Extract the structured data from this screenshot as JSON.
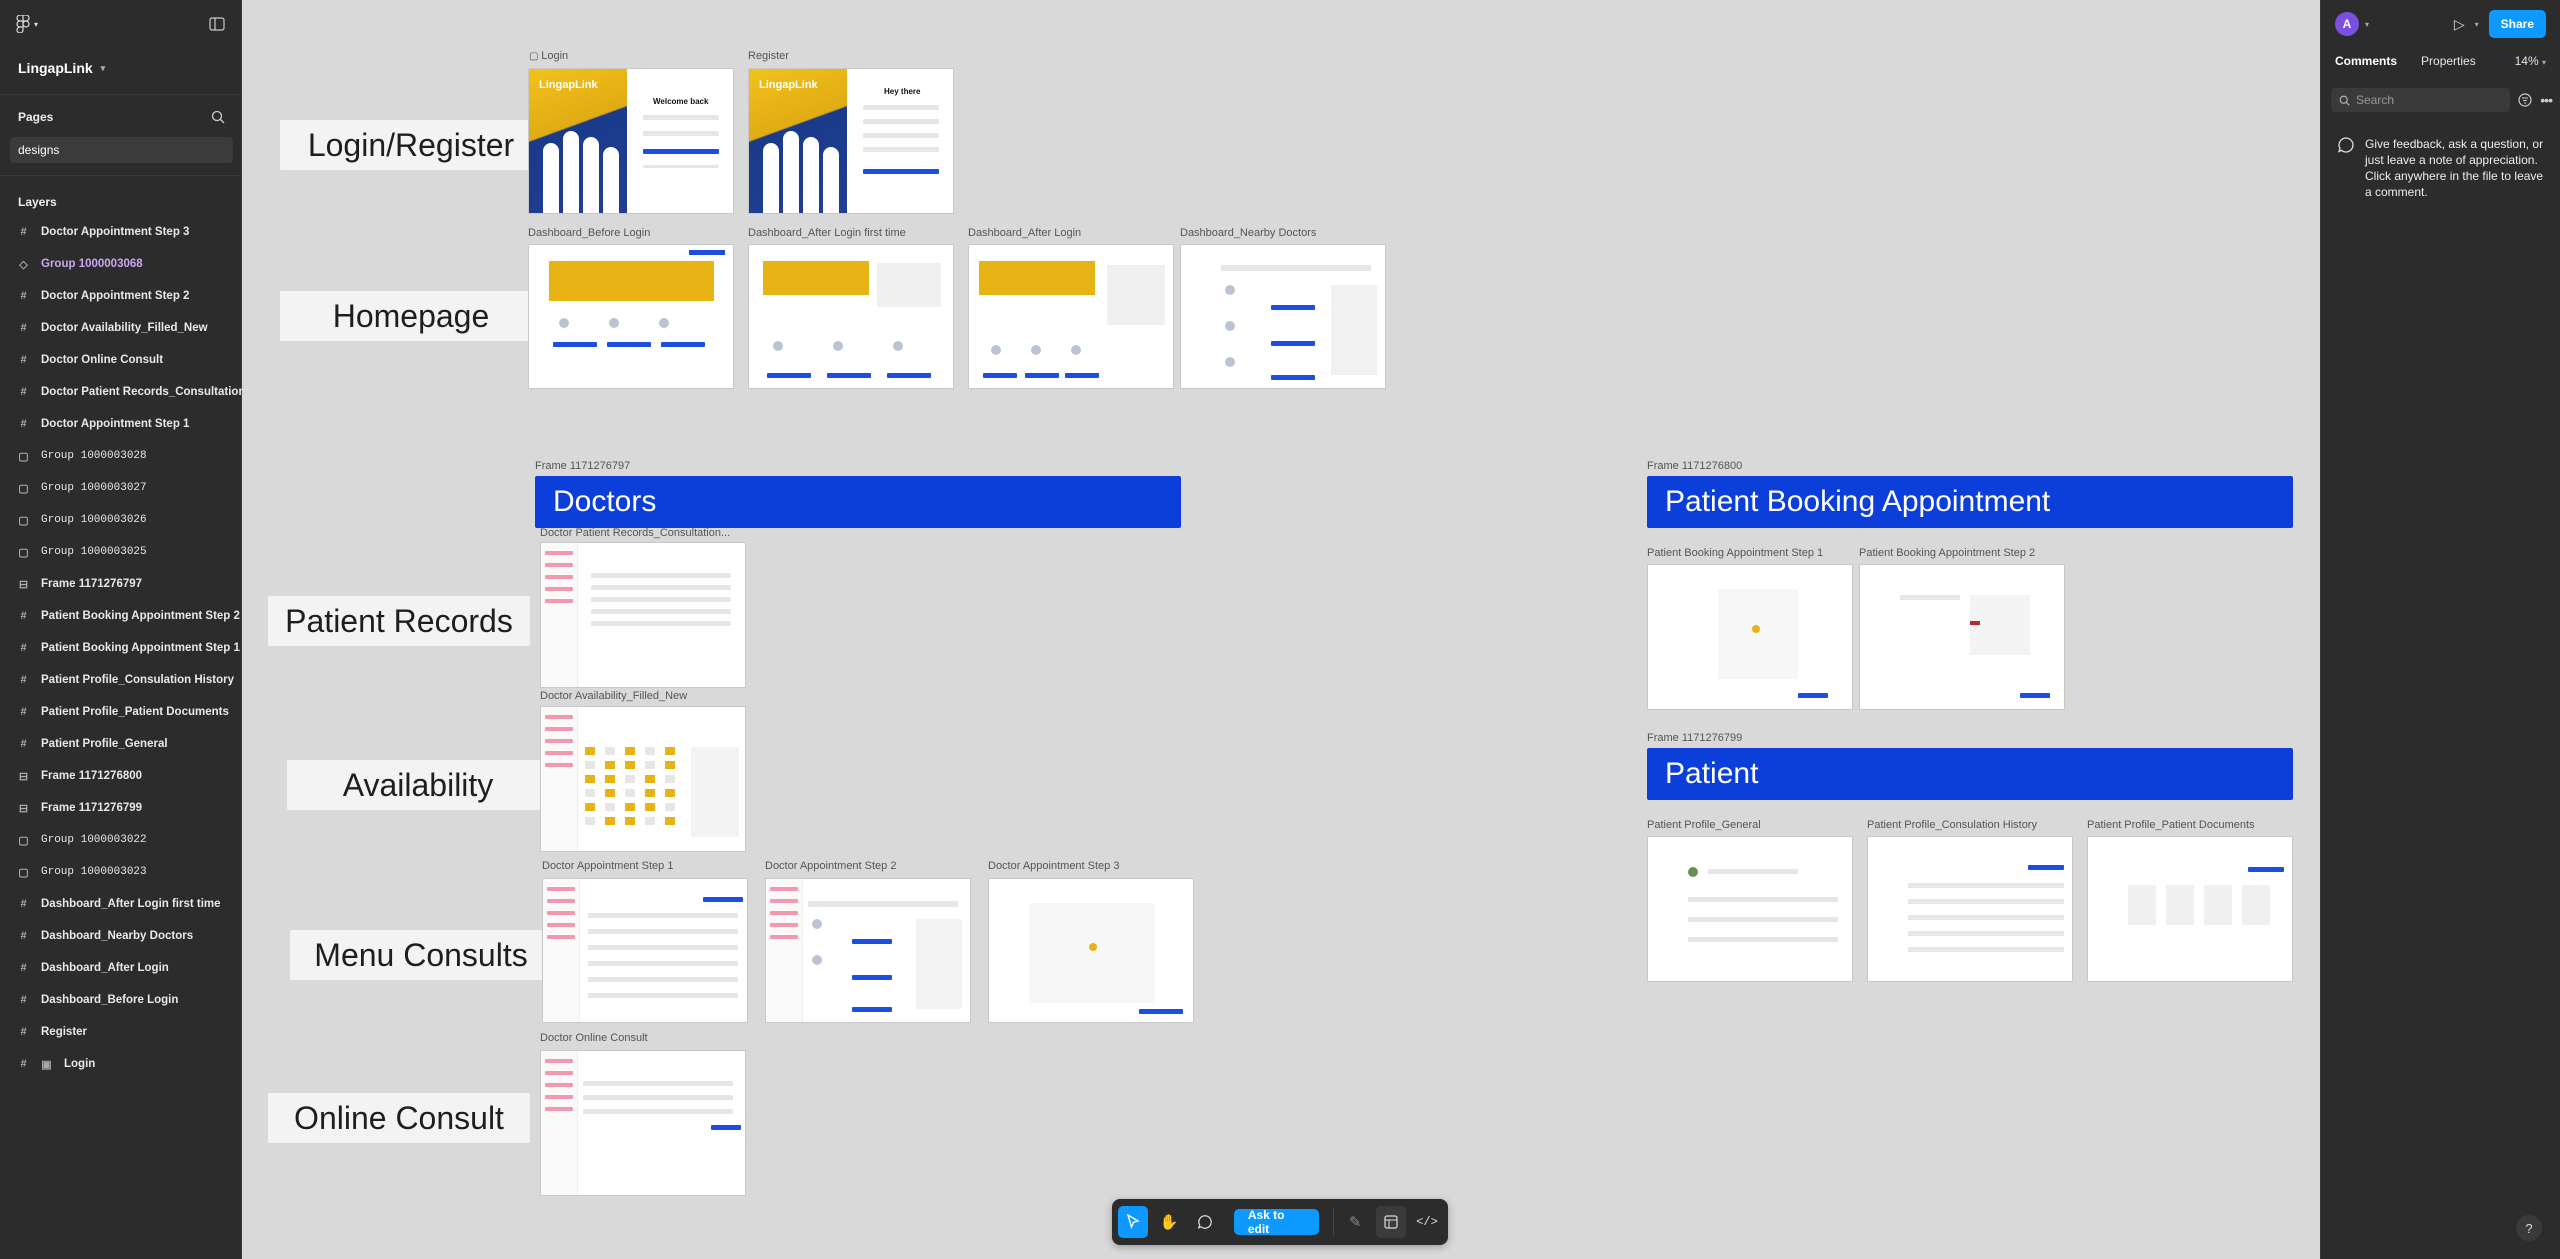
{
  "app": {
    "project_name": "LingapLink"
  },
  "left_panel": {
    "pages_title": "Pages",
    "current_page": "designs",
    "layers_title": "Layers",
    "layers": [
      {
        "label": "Doctor Appointment Step 3",
        "icon": "frame-icon",
        "style": "frame"
      },
      {
        "label": "Group 1000003068",
        "icon": "component-icon",
        "style": "purple"
      },
      {
        "label": "Doctor Appointment Step 2",
        "icon": "frame-icon",
        "style": "frame"
      },
      {
        "label": "Doctor Availability_Filled_New",
        "icon": "frame-icon",
        "style": "frame"
      },
      {
        "label": "Doctor Online Consult",
        "icon": "frame-icon",
        "style": "frame"
      },
      {
        "label": "Doctor Patient Records_Consultation",
        "icon": "frame-icon",
        "style": "frame"
      },
      {
        "label": "Doctor Appointment Step 1",
        "icon": "frame-icon",
        "style": "frame"
      },
      {
        "label": "Group 1000003028",
        "icon": "group-icon",
        "style": "mono"
      },
      {
        "label": "Group 1000003027",
        "icon": "group-icon",
        "style": "mono"
      },
      {
        "label": "Group 1000003026",
        "icon": "group-icon",
        "style": "mono"
      },
      {
        "label": "Group 1000003025",
        "icon": "group-icon",
        "style": "mono"
      },
      {
        "label": "Frame 1171276797",
        "icon": "autolayout-icon",
        "style": "frame"
      },
      {
        "label": "Patient Booking Appointment Step 2",
        "icon": "frame-icon",
        "style": "frame"
      },
      {
        "label": "Patient Booking Appointment Step 1",
        "icon": "frame-icon",
        "style": "frame"
      },
      {
        "label": "Patient Profile_Consulation History",
        "icon": "frame-icon",
        "style": "frame"
      },
      {
        "label": "Patient Profile_Patient Documents",
        "icon": "frame-icon",
        "style": "frame"
      },
      {
        "label": "Patient Profile_General",
        "icon": "frame-icon",
        "style": "frame"
      },
      {
        "label": "Frame 1171276800",
        "icon": "autolayout-icon",
        "style": "frame"
      },
      {
        "label": "Frame 1171276799",
        "icon": "autolayout-icon",
        "style": "frame"
      },
      {
        "label": "Group 1000003022",
        "icon": "group-icon",
        "style": "mono"
      },
      {
        "label": "Group 1000003023",
        "icon": "group-icon",
        "style": "mono"
      },
      {
        "label": "Dashboard_After Login first time",
        "icon": "frame-icon",
        "style": "frame"
      },
      {
        "label": "Dashboard_Nearby Doctors",
        "icon": "frame-icon",
        "style": "frame"
      },
      {
        "label": "Dashboard_After Login",
        "icon": "frame-icon",
        "style": "frame"
      },
      {
        "label": "Dashboard_Before Login",
        "icon": "frame-icon",
        "style": "frame"
      },
      {
        "label": "Register",
        "icon": "frame-icon",
        "style": "frame"
      },
      {
        "label": "Login",
        "icon": "frame-icon",
        "style": "frame",
        "extra_icon": "image-icon"
      }
    ]
  },
  "right_panel": {
    "avatar_initial": "A",
    "share_label": "Share",
    "tabs": [
      "Comments",
      "Properties"
    ],
    "active_tab": "Comments",
    "zoom": "14%",
    "search_placeholder": "Search",
    "empty_comment_text": "Give feedback, ask a question, or just leave a note of appreciation. Click anywhere in the file to leave a comment.",
    "help_label": "?"
  },
  "canvas": {
    "section_labels": [
      "Login/Register",
      "Homepage",
      "Patient Records",
      "Availability",
      "Menu Consults",
      "Online Consult"
    ],
    "frames": {
      "login": "Login",
      "register": "Register",
      "dash_before": "Dashboard_Before Login",
      "dash_first": "Dashboard_After Login first time",
      "dash_after": "Dashboard_After Login",
      "dash_nearby": "Dashboard_Nearby Doctors",
      "frame_doctors": "Frame 1171276797",
      "patient_records": "Doctor Patient Records_Consultation...",
      "availability": "Doctor Availability_Filled_New",
      "appt1": "Doctor Appointment Step 1",
      "appt2": "Doctor Appointment Step 2",
      "appt3": "Doctor Appointment Step 3",
      "online": "Doctor Online Consult",
      "frame_booking": "Frame 1171276800",
      "booking1": "Patient Booking Appointment Step 1",
      "booking2": "Patient Booking Appointment Step 2",
      "frame_patient": "Frame 1171276799",
      "profile_general": "Patient Profile_General",
      "profile_history": "Patient Profile_Consulation History",
      "profile_docs": "Patient Profile_Patient Documents"
    },
    "banners": {
      "doctors": "Doctors",
      "booking": "Patient Booking Appointment",
      "patient": "Patient"
    },
    "thumb_text": {
      "brand": "LingapLink",
      "welcome_back": "Welcome back",
      "hey_there": "Hey there"
    }
  },
  "toolbar": {
    "ask_label": "Ask to edit"
  },
  "colors": {
    "accent": "#0d99ff",
    "banner_blue": "#0c3fd9",
    "brand_yellow": "#e8b315"
  }
}
